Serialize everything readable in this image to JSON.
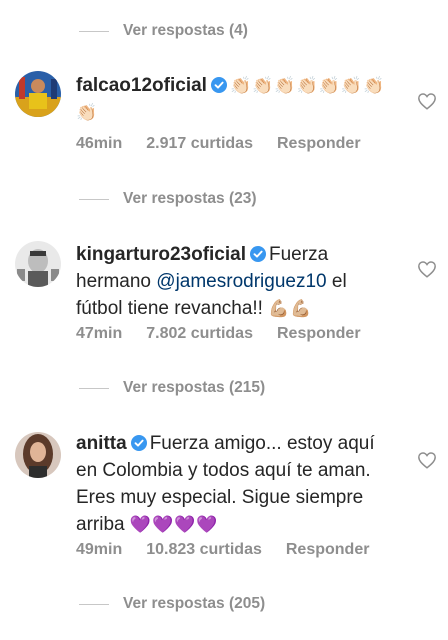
{
  "threads": [
    {
      "view_replies": "Ver respostas (4)"
    },
    {
      "username": "falcao12oficial",
      "body": "",
      "emoji": "👏🏻👏🏻👏🏻👏🏻👏🏻👏🏻👏🏻👏🏻",
      "time": "46min",
      "likes": "2.917 curtidas",
      "reply": "Responder",
      "view_replies": "Ver respostas (23)"
    },
    {
      "username": "kingarturo23oficial",
      "body_start": "Fuerza hermano ",
      "mention": "@jamesrodriguez10",
      "body_end": " el fútbol tiene revancha!! ",
      "emoji": "💪🏼💪🏼",
      "time": "47min",
      "likes": "7.802 curtidas",
      "reply": "Responder",
      "view_replies": "Ver respostas (215)"
    },
    {
      "username": "anitta",
      "body": "Fuerza amigo... estoy aquí en Colombia y todos aquí te aman. Eres muy especial. Sigue siempre arriba ",
      "emoji": "💜💜💜💜",
      "time": "49min",
      "likes": "10.823 curtidas",
      "reply": "Responder",
      "view_replies": "Ver respostas (205)"
    }
  ],
  "colors": {
    "text": "#262626",
    "secondary": "#8e8e8e",
    "mention": "#00376b",
    "verified": "#3897f0",
    "divider": "#c7c7c7"
  },
  "icons": {
    "verified": "verified-badge-icon",
    "like": "heart-outline-icon"
  }
}
